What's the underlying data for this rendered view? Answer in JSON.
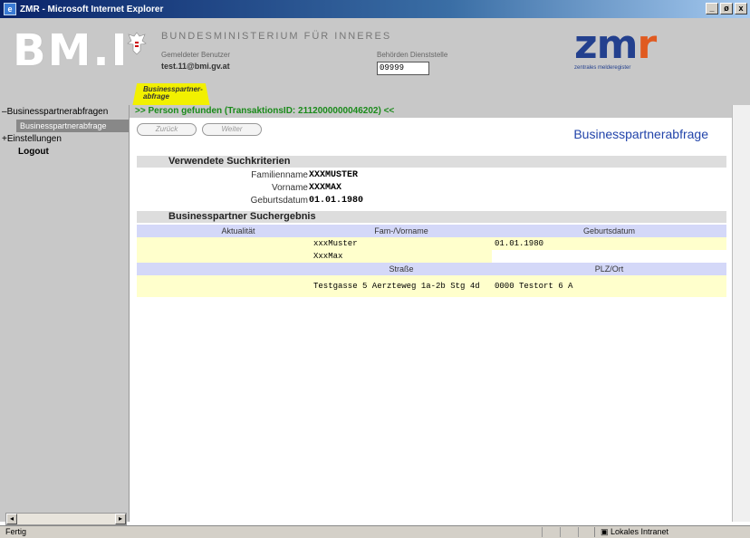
{
  "window": {
    "title": "ZMR - Microsoft Internet Explorer",
    "buttons": [
      "_",
      "ø",
      "x"
    ]
  },
  "header": {
    "logo": "BM.I",
    "ministry": "BUNDESMINISTERIUM FÜR INNERES",
    "user_label": "Gemeldeter Benutzer",
    "user_value": "test.11@bmi.gv.at",
    "dept_label": "Behörden Dienststelle",
    "dept_value": "09999",
    "zmr_logo_main": "zm",
    "zmr_logo_end": "r",
    "zmr_sub": "zentrales melderegister"
  },
  "tab": {
    "label": "Businesspartner-abfrage"
  },
  "sidebar": {
    "items": [
      {
        "prefix": "–",
        "label": "Businesspartnerabfragen"
      },
      {
        "prefix": "",
        "label": "Businesspartnerabfrage"
      },
      {
        "prefix": "+",
        "label": "Einstellungen"
      },
      {
        "prefix": "",
        "label": "Logout"
      }
    ],
    "scroll_left": "◂",
    "scroll_right": "▸"
  },
  "main": {
    "status_line": ">>  Person gefunden (TransaktionsID: 2112000000046202)  <<",
    "buttons": {
      "back": "Zurück",
      "next": "Weiter"
    },
    "page_title": "Businesspartnerabfrage",
    "criteria_title": "Verwendete Suchkriterien",
    "criteria": [
      {
        "key": "Familienname",
        "value": "XXXMUSTER"
      },
      {
        "key": "Vorname",
        "value": "XXXMAX"
      },
      {
        "key": "Geburtsdatum",
        "value": "01.01.1980"
      }
    ],
    "results_title": "Businesspartner Suchergebnis",
    "results": {
      "col_aktualitaet": "Aktualität",
      "col_name": "Fam-/Vorname",
      "col_geb": "Geburtsdatum",
      "familienname": "xxxMuster",
      "vorname": "XxxMax",
      "geburtsdatum": "01.01.1980",
      "col_strasse": "Straße",
      "col_plz": "PLZ/Ort",
      "strasse": "Testgasse 5 Aerzteweg 1a-2b Stg 4d",
      "plz_ort": "0000 Testort 6 A"
    }
  },
  "statusbar": {
    "left": "Fertig",
    "zone": "Lokales Intranet"
  }
}
